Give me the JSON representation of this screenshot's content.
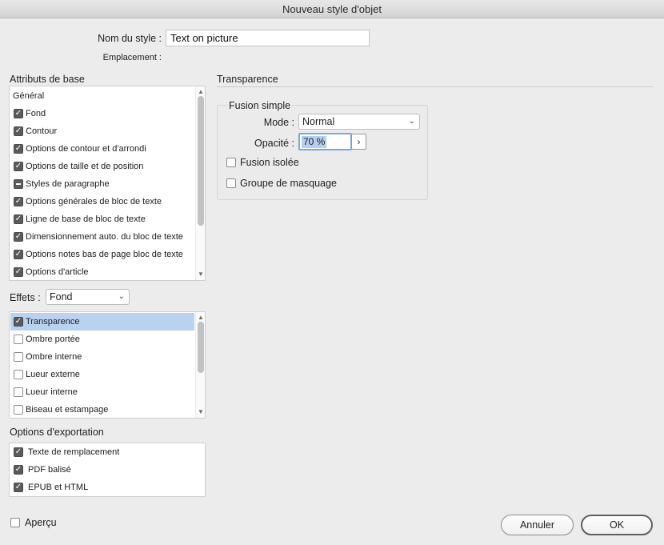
{
  "window": {
    "title": "Nouveau style d'objet"
  },
  "style_name": {
    "label": "Nom du style :",
    "value": "Text on picture"
  },
  "location": {
    "label": "Emplacement :"
  },
  "basic_attributes": {
    "title": "Attributs de base",
    "items": [
      {
        "label": "Général",
        "state": "none"
      },
      {
        "label": "Fond",
        "state": "checked"
      },
      {
        "label": "Contour",
        "state": "checked"
      },
      {
        "label": "Options de contour et d'arrondi",
        "state": "checked"
      },
      {
        "label": "Options de taille et de position",
        "state": "checked"
      },
      {
        "label": "Styles de paragraphe",
        "state": "mixed"
      },
      {
        "label": "Options générales de bloc de texte",
        "state": "checked"
      },
      {
        "label": "Ligne de base de bloc de texte",
        "state": "checked"
      },
      {
        "label": "Dimensionnement auto. du bloc de texte",
        "state": "checked"
      },
      {
        "label": "Options notes bas de page bloc de texte",
        "state": "checked"
      },
      {
        "label": "Options d'article",
        "state": "checked"
      }
    ]
  },
  "effects": {
    "label": "Effets :",
    "target": "Fond",
    "items": [
      {
        "label": "Transparence",
        "state": "checked",
        "selected": true
      },
      {
        "label": "Ombre portée",
        "state": "unchecked"
      },
      {
        "label": "Ombre interne",
        "state": "unchecked"
      },
      {
        "label": "Lueur externe",
        "state": "unchecked"
      },
      {
        "label": "Lueur interne",
        "state": "unchecked"
      },
      {
        "label": "Biseau et estampage",
        "state": "unchecked"
      }
    ]
  },
  "export_options": {
    "title": "Options d'exportation",
    "items": [
      {
        "label": "Texte de remplacement",
        "state": "checked"
      },
      {
        "label": "PDF balisé",
        "state": "checked"
      },
      {
        "label": "EPUB et HTML",
        "state": "checked"
      }
    ]
  },
  "panel": {
    "title": "Transparence",
    "group_title": "Fusion simple",
    "mode_label": "Mode :",
    "mode_value": "Normal",
    "opacity_label": "Opacité :",
    "opacity_value": "70 %",
    "isolate_blending": "Fusion isolée",
    "knockout_group": "Groupe de masquage"
  },
  "preview": {
    "label": "Aperçu",
    "checked": false
  },
  "buttons": {
    "cancel": "Annuler",
    "ok": "OK"
  },
  "icons": {
    "chevron": "chevron-down-icon",
    "checkmark": "checkmark-icon",
    "stepper": "chevron-right-icon"
  }
}
